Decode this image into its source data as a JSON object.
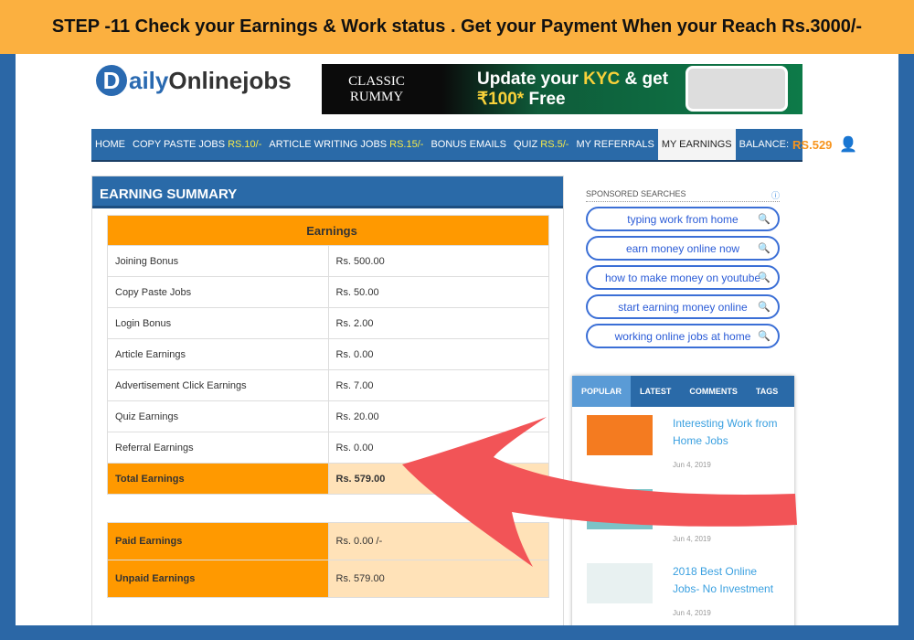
{
  "banner": "STEP -11 Check your Earnings & Work status . Get your  Payment When your Reach Rs.3000/-",
  "logo": {
    "d": "D",
    "daily": "aily",
    "rest": "Onlinejobs"
  },
  "ad": {
    "brand": "CLASSIC RUMMY",
    "line1a": "Update your ",
    "line1b": "KYC",
    "line1c": " & get",
    "line2a": "₹100*",
    "line2b": " Free"
  },
  "nav": {
    "items": [
      {
        "label": "HOME"
      },
      {
        "label": "COPY PASTE JOBS",
        "extra": "RS.10/-"
      },
      {
        "label": "ARTICLE WRITING JOBS",
        "extra": "RS.15/-"
      },
      {
        "label": "BONUS EMAILS"
      },
      {
        "label": "QUIZ",
        "extra": "RS.5/-"
      },
      {
        "label": "MY REFERRALS"
      },
      {
        "label": "MY EARNINGS"
      }
    ],
    "balance_label": "BALANCE:",
    "balance": "RS.529"
  },
  "summary": {
    "title": "EARNING SUMMARY",
    "header": "Earnings",
    "rows": [
      [
        "Joining Bonus",
        "Rs. 500.00"
      ],
      [
        "Copy Paste Jobs",
        "Rs. 50.00"
      ],
      [
        "Login Bonus",
        "Rs. 2.00"
      ],
      [
        "Article Earnings",
        "Rs. 0.00"
      ],
      [
        "Advertisement Click Earnings",
        "Rs. 7.00"
      ],
      [
        "Quiz Earnings",
        "Rs. 20.00"
      ],
      [
        "Referral Earnings",
        "Rs. 0.00"
      ]
    ],
    "total": [
      "Total Earnings",
      "Rs. 579.00"
    ],
    "paid": [
      "Paid Earnings",
      "Rs. 0.00 /-"
    ],
    "unpaid": [
      "Unpaid Earnings",
      "Rs. 579.00"
    ]
  },
  "sponsored": {
    "label": "SPONSORED SEARCHES",
    "items": [
      "typing work from home",
      "earn money online now",
      "how to make money on youtube",
      "start earning money online",
      "working online jobs at home"
    ]
  },
  "widget": {
    "tabs": [
      "POPULAR",
      "LATEST",
      "COMMENTS",
      "TAGS"
    ],
    "posts": [
      {
        "title": "Interesting Work from Home Jobs",
        "date": "Jun 4, 2019"
      },
      {
        "title": "",
        "date": "Jun 4, 2019"
      },
      {
        "title": "2018 Best Online Jobs- No Investment",
        "date": "Jun 4, 2019"
      }
    ]
  }
}
